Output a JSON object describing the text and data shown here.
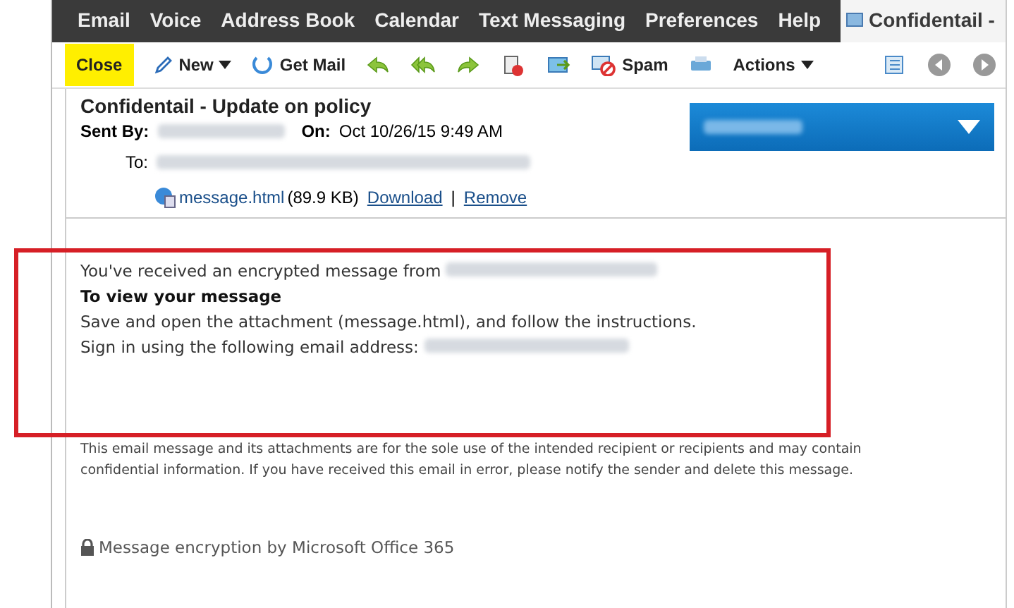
{
  "nav": {
    "items": [
      {
        "label": "Email",
        "selected": false
      },
      {
        "label": "Voice",
        "selected": false
      },
      {
        "label": "Address Book",
        "selected": false
      },
      {
        "label": "Calendar",
        "selected": false
      },
      {
        "label": "Text Messaging",
        "selected": false
      },
      {
        "label": "Preferences",
        "selected": false
      },
      {
        "label": "Help",
        "selected": false
      },
      {
        "label": "Confidentail -",
        "selected": true
      }
    ]
  },
  "toolbar": {
    "items": [
      {
        "kind": "close",
        "label": "Close"
      },
      {
        "kind": "new",
        "label": "New"
      },
      {
        "kind": "getmail",
        "label": "Get Mail"
      },
      {
        "kind": "reply"
      },
      {
        "kind": "replyall"
      },
      {
        "kind": "forward"
      },
      {
        "kind": "delete"
      },
      {
        "kind": "move"
      },
      {
        "kind": "spam",
        "label": "Spam"
      },
      {
        "kind": "print"
      },
      {
        "kind": "actions",
        "label": "Actions"
      },
      {
        "kind": "spacer"
      },
      {
        "kind": "layout"
      },
      {
        "kind": "prev"
      },
      {
        "kind": "next"
      }
    ]
  },
  "message": {
    "subject": "Confidentail - Update on policy",
    "sent_by_label": "Sent By:",
    "on_label": "On:",
    "date": "Oct 10/26/15 9:49 AM",
    "to_label": "To:",
    "attachment": {
      "name": "message.html",
      "size": "(89.9 KB)",
      "download": "Download",
      "separator": "|",
      "remove": "Remove"
    },
    "body": {
      "intro": "You've received an encrypted message from",
      "heading": "To view your message",
      "line1": "Save and open the attachment (message.html), and follow the instructions.",
      "line2": "Sign in using the following email address:"
    },
    "disclaimer": "This email message and its attachments are for the sole use of the intended recipient or recipients and may contain confidential information. If you have received this email in error, please notify the sender and delete this message.",
    "footer": "Message encryption by Microsoft Office 365"
  }
}
